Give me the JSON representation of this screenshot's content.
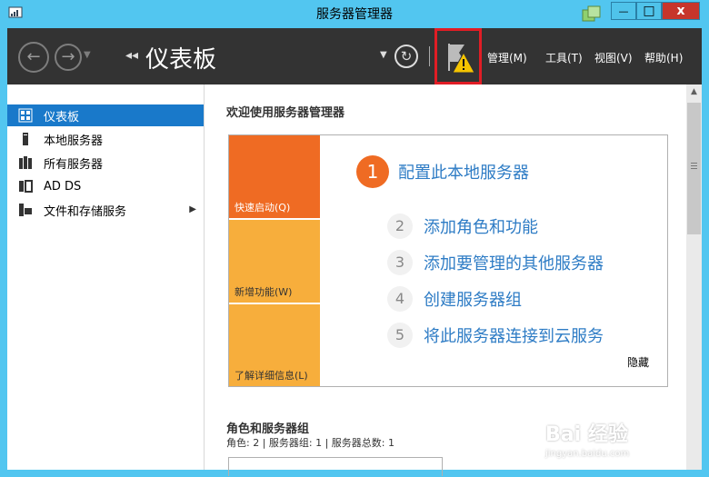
{
  "window": {
    "title": "服务器管理器",
    "close_glyph": "x",
    "min_glyph": "—",
    "max_glyph": "□"
  },
  "toolbar": {
    "breadcrumb_arrows": "◂◂",
    "title": "仪表板",
    "menus": [
      "管理(M)",
      "工具(T)",
      "视图(V)",
      "帮助(H)"
    ]
  },
  "sidebar": {
    "items": [
      {
        "label": "仪表板",
        "icon": "dashboard-icon",
        "active": true
      },
      {
        "label": "本地服务器",
        "icon": "server-icon",
        "active": false
      },
      {
        "label": "所有服务器",
        "icon": "servers-icon",
        "active": false
      },
      {
        "label": "AD DS",
        "icon": "ad-ds-icon",
        "active": false
      },
      {
        "label": "文件和存储服务",
        "icon": "file-storage-icon",
        "active": false,
        "has_submenu": true
      }
    ]
  },
  "main": {
    "welcome": "欢迎使用服务器管理器",
    "tiles": [
      "快速启动(Q)",
      "新增功能(W)",
      "了解详细信息(L)"
    ],
    "steps": [
      {
        "num": "1",
        "label": "配置此本地服务器"
      },
      {
        "num": "2",
        "label": "添加角色和功能"
      },
      {
        "num": "3",
        "label": "添加要管理的其他服务器"
      },
      {
        "num": "4",
        "label": "创建服务器组"
      },
      {
        "num": "5",
        "label": "将此服务器连接到云服务"
      }
    ],
    "hide": "隐藏",
    "roles_title": "角色和服务器组",
    "roles_sub": "角色: 2 | 服务器组: 1 | 服务器总数: 1"
  },
  "watermark": {
    "brand": "Bai 经验",
    "url": "jingyan.baidu.com"
  },
  "colors": {
    "accent": "#1979ca",
    "orange": "#ef6b23",
    "yellow": "#f7ae3c",
    "highlight_border": "#e11d25"
  }
}
